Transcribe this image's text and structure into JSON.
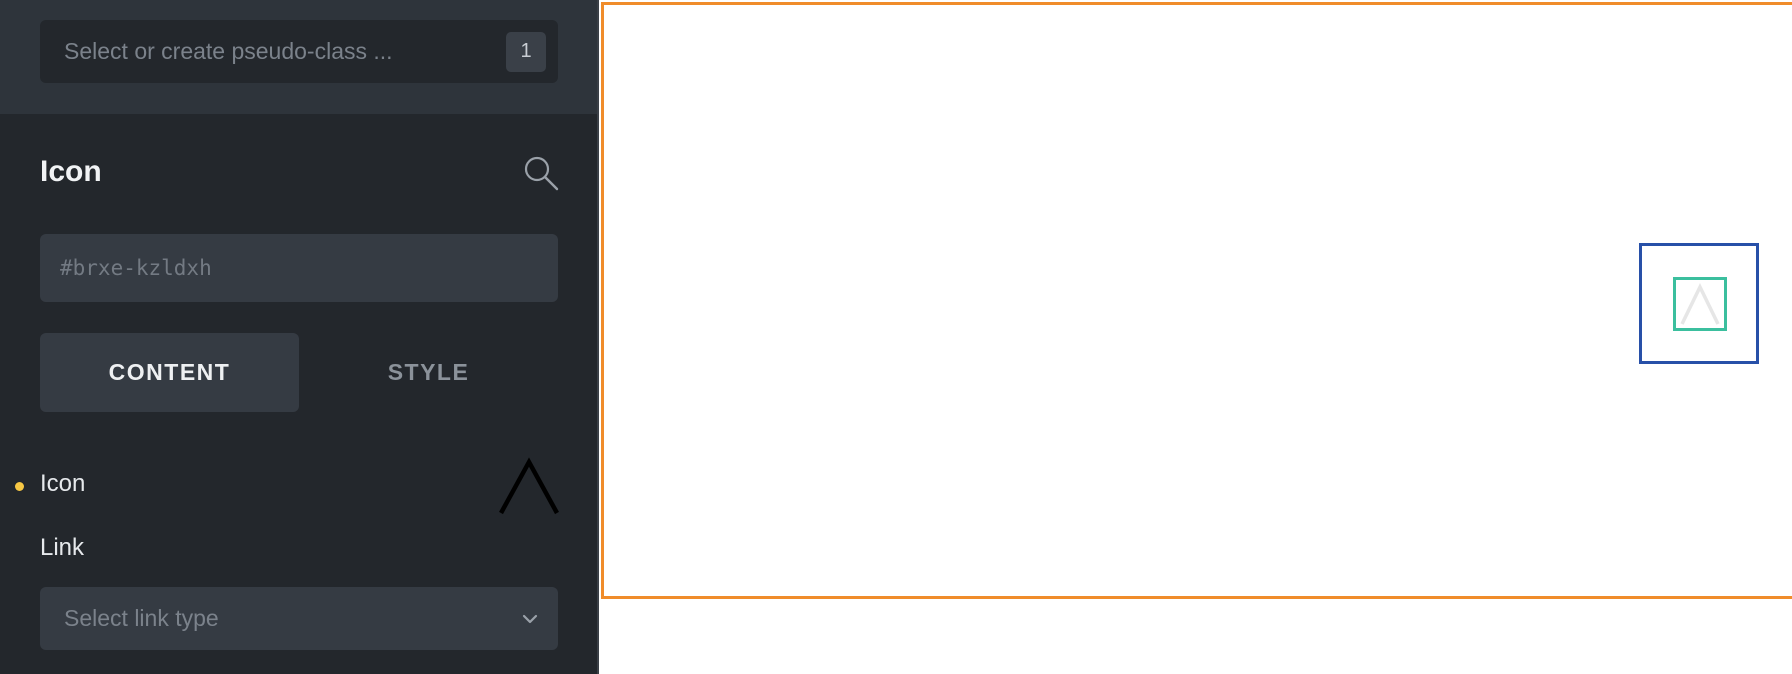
{
  "sidebar": {
    "pseudo_class": {
      "placeholder": "Select or create pseudo-class ...",
      "count": "1"
    },
    "title": "Icon",
    "search_icon": "search-icon",
    "element_id": {
      "placeholder": "#brxe-kzldxh"
    },
    "tabs": [
      {
        "label": "CONTENT",
        "active": true
      },
      {
        "label": "STYLE",
        "active": false
      }
    ],
    "fields": {
      "icon": {
        "label": "Icon",
        "modified_indicator_color": "#f6c744",
        "selected_icon": "caret-up-icon"
      },
      "link": {
        "label": "Link",
        "placeholder": "Select link type",
        "dropdown_icon": "chevron-down-icon"
      }
    }
  },
  "canvas": {
    "section_outline_color": "#f08c2a",
    "selected_element_outline_color": "#2850a8",
    "icon_outline_color": "#3bbf9e"
  }
}
